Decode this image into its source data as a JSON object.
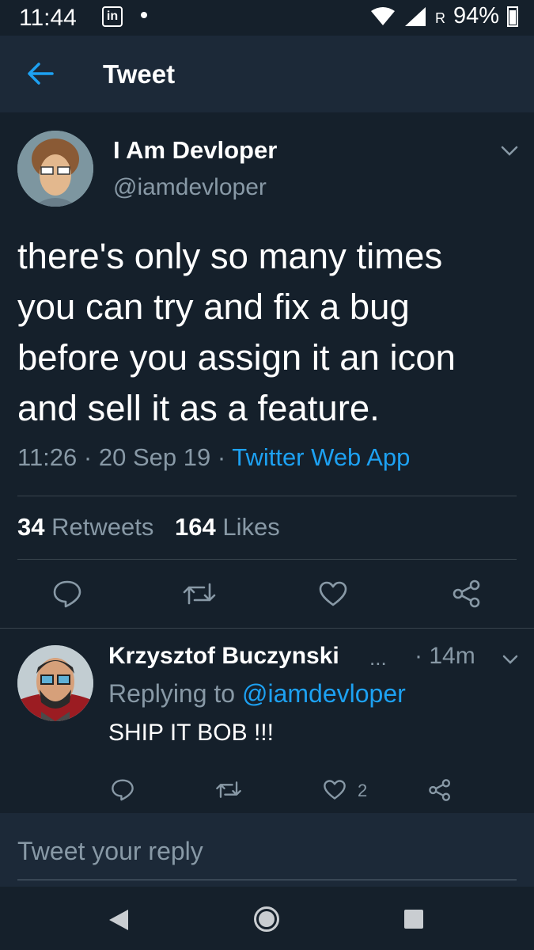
{
  "status_bar": {
    "time": "11:44",
    "notification_icon": "linkedin-icon",
    "linkedin_glyph": "in",
    "roaming": "R",
    "battery": "94%"
  },
  "app_bar": {
    "title": "Tweet",
    "back_icon": "arrow-left-icon"
  },
  "tweet": {
    "author_name": "I Am Devloper",
    "author_handle": "@iamdevloper",
    "lines": [
      "there's only so many times",
      "you can try and fix a bug",
      "before you assign it an icon",
      "and sell it as a feature."
    ],
    "time": "11:26",
    "date": "20 Sep 19",
    "source": "Twitter Web App",
    "retweets_count": "34",
    "retweets_label": "Retweets",
    "likes_count": "164",
    "likes_label": "Likes"
  },
  "reply": {
    "author_name": "Krzysztof Buczynski",
    "ellipsis": "...",
    "time": "· 14m",
    "replying_prefix": "Replying to",
    "replying_to": "@iamdevloper",
    "text": "SHIP IT BOB !!!",
    "like_count": "2"
  },
  "composer": {
    "placeholder": "Tweet your reply"
  },
  "colors": {
    "background": "#15202b",
    "bar": "#1c2938",
    "accent": "#1da1f2",
    "muted": "#8899a6",
    "divider": "#38444d"
  }
}
